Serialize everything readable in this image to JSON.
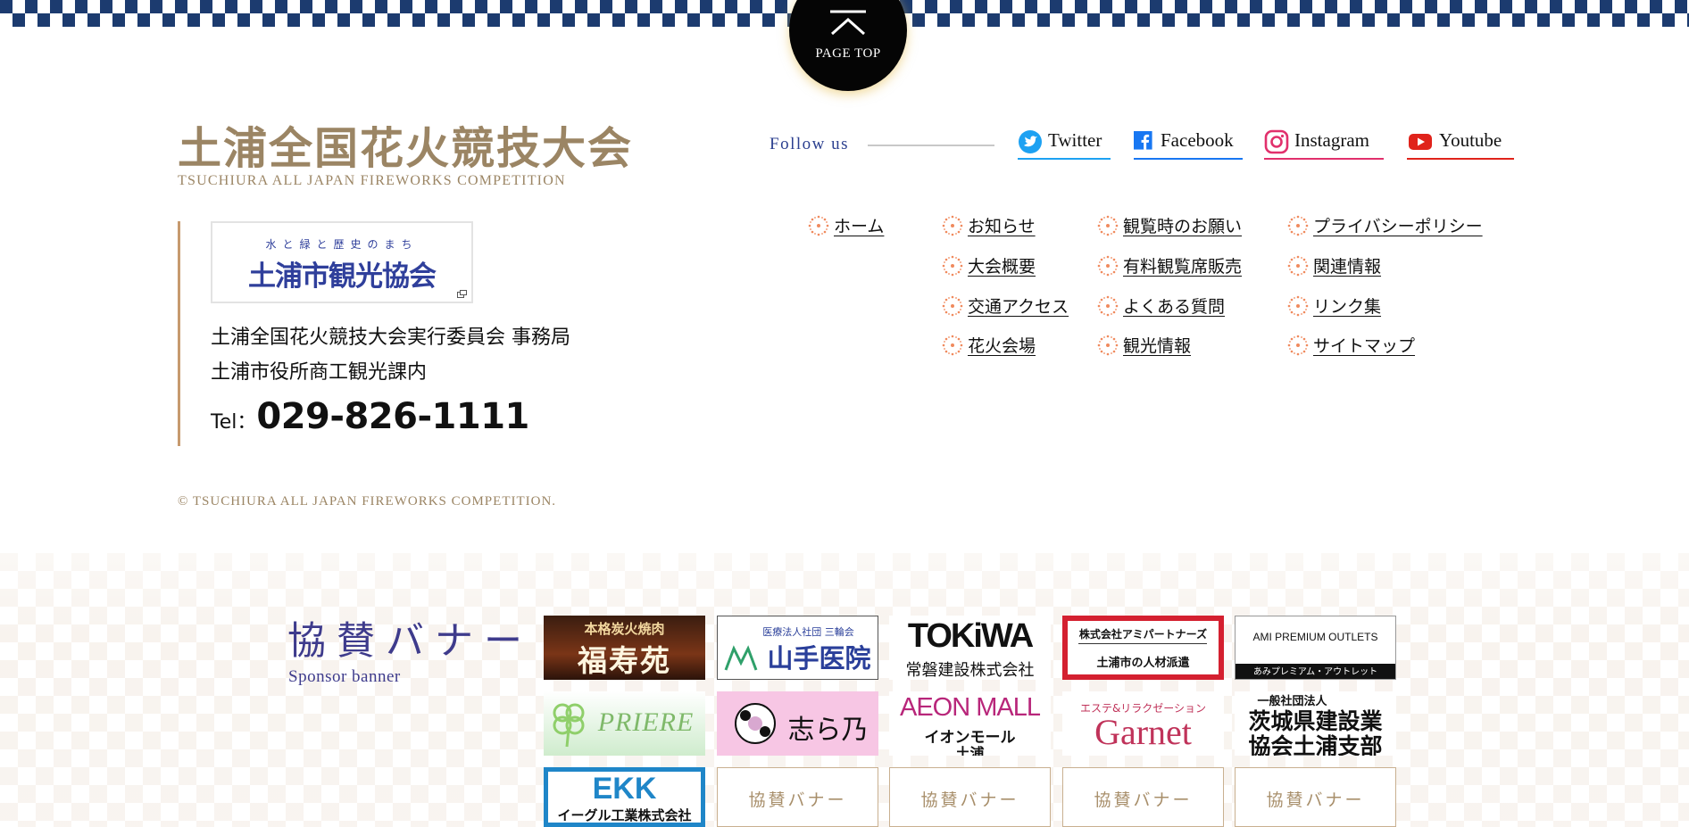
{
  "page_top": {
    "label": "PAGE TOP"
  },
  "site": {
    "title_jp": "土浦全国花火競技大会",
    "title_en": "TSUCHIURA  ALL JAPAN FIREWORKS COMPETITION"
  },
  "association_banner": {
    "tagline": "水と緑と歴史のまち",
    "name": "土浦市観光協会"
  },
  "office": {
    "name": "土浦全国花火競技大会実行委員会 事務局",
    "department": "土浦市役所商工観光課内",
    "tel_label": "Tel：",
    "tel_number": "029-826-1111"
  },
  "copyright": "© TSUCHIURA  ALL JAPAN FIREWORKS COMPETITION.",
  "follow": {
    "label": "Follow us",
    "links": [
      {
        "label": "Twitter",
        "icon": "twitter-icon",
        "color": "#1da1f2"
      },
      {
        "label": "Facebook",
        "icon": "facebook-icon",
        "color": "#1877f2"
      },
      {
        "label": "Instagram",
        "icon": "instagram-icon",
        "color": "#e1306c"
      },
      {
        "label": "Youtube",
        "icon": "youtube-icon",
        "color": "#e0231b"
      }
    ]
  },
  "footer_nav": {
    "col1": [
      "ホーム"
    ],
    "col2": [
      "お知らせ",
      "大会概要",
      "交通アクセス",
      "花火会場"
    ],
    "col3": [
      "観覧時のお願い",
      "有料観覧席販売",
      "よくある質問",
      "観光情報"
    ],
    "col4": [
      "プライバシーポリシー",
      "関連情報",
      "リンク集",
      "サイトマップ"
    ]
  },
  "sponsors": {
    "title": "協賛バナー",
    "subtitle": "Sponsor banner",
    "banners": [
      {
        "line1": "本格炭火焼肉",
        "line2": "福寿苑"
      },
      {
        "line1": "医療法人社団 三輪会",
        "line2": "山手医院"
      },
      {
        "line1": "TOKiWA",
        "line2": "常磐建設株式会社"
      },
      {
        "line1": "株式会社アミパートナーズ",
        "line2": "土浦市の人材派遣"
      },
      {
        "line1": "AMI PREMIUM OUTLETS",
        "line2": "あみプレミアム・アウトレット"
      },
      {
        "line1": "PRIERE"
      },
      {
        "line1": "志ら乃"
      },
      {
        "line1": "AEON MALL",
        "line2": "イオンモール",
        "line3": "土浦"
      },
      {
        "line1": "エステ&リラクゼーション",
        "line2": "Garnet"
      },
      {
        "line1": "一般社団法人",
        "line2": "茨城県建設業",
        "line3": "協会土浦支部"
      },
      {
        "line1": "EKK",
        "line2": "イーグル工業株式会社"
      }
    ],
    "placeholder_label": "協賛バナー"
  },
  "colors": {
    "navy": "#1c3b6f",
    "gold": "#9b8564",
    "accent_border": "#c79a6e",
    "sponsor_title": "#3e3b8c"
  }
}
